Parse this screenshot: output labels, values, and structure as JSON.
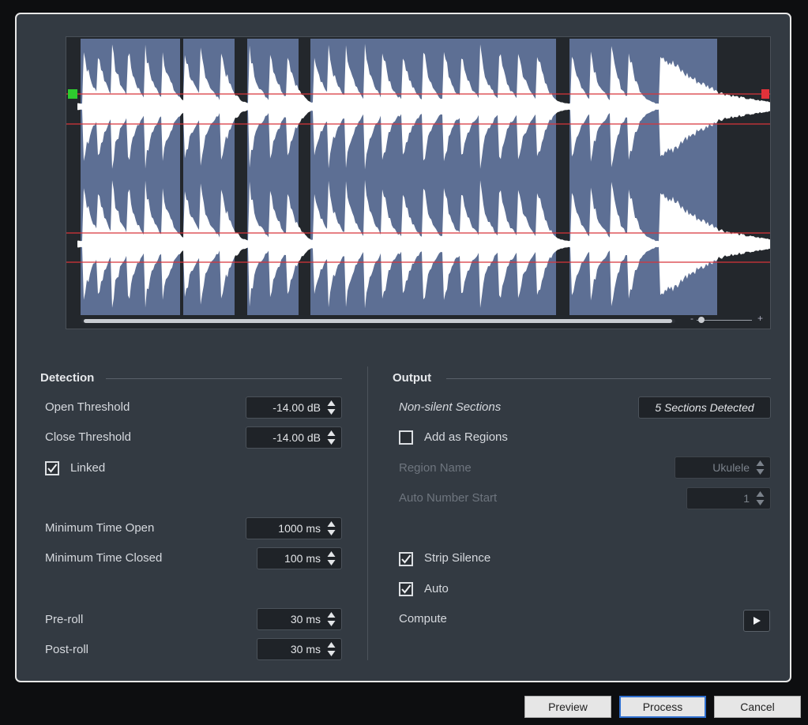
{
  "waveform": {
    "sections_total": 5,
    "open_threshold_db": -14.0,
    "close_threshold_db": -14.0
  },
  "detection": {
    "title": "Detection",
    "open_threshold": {
      "label": "Open Threshold",
      "value": "-14.00 dB"
    },
    "close_threshold": {
      "label": "Close Threshold",
      "value": "-14.00 dB"
    },
    "linked": {
      "label": "Linked",
      "checked": true
    },
    "min_time_open": {
      "label": "Minimum Time Open",
      "value": "1000 ms"
    },
    "min_time_closed": {
      "label": "Minimum Time Closed",
      "value": "100 ms"
    },
    "pre_roll": {
      "label": "Pre-roll",
      "value": "30 ms"
    },
    "post_roll": {
      "label": "Post-roll",
      "value": "30 ms"
    }
  },
  "output": {
    "title": "Output",
    "non_silent": {
      "label": "Non-silent Sections",
      "value": "5 Sections Detected"
    },
    "add_as_regions": {
      "label": "Add as Regions",
      "checked": false
    },
    "region_name": {
      "label": "Region Name",
      "value": "Ukulele"
    },
    "auto_number_start": {
      "label": "Auto Number Start",
      "value": "1"
    },
    "strip_silence": {
      "label": "Strip Silence",
      "checked": true
    },
    "auto": {
      "label": "Auto",
      "checked": true
    },
    "compute": {
      "label": "Compute"
    }
  },
  "zoom": {
    "minus": "-",
    "plus": "+"
  },
  "buttons": {
    "preview": "Preview",
    "process": "Process",
    "cancel": "Cancel"
  },
  "colors": {
    "section_fill": "#5d6f94",
    "waveform": "#ffffff",
    "threshold_line": "#d8343a",
    "open_marker": "#2ec92e",
    "close_marker": "#e0323a",
    "process_border": "#2f6fcf"
  }
}
